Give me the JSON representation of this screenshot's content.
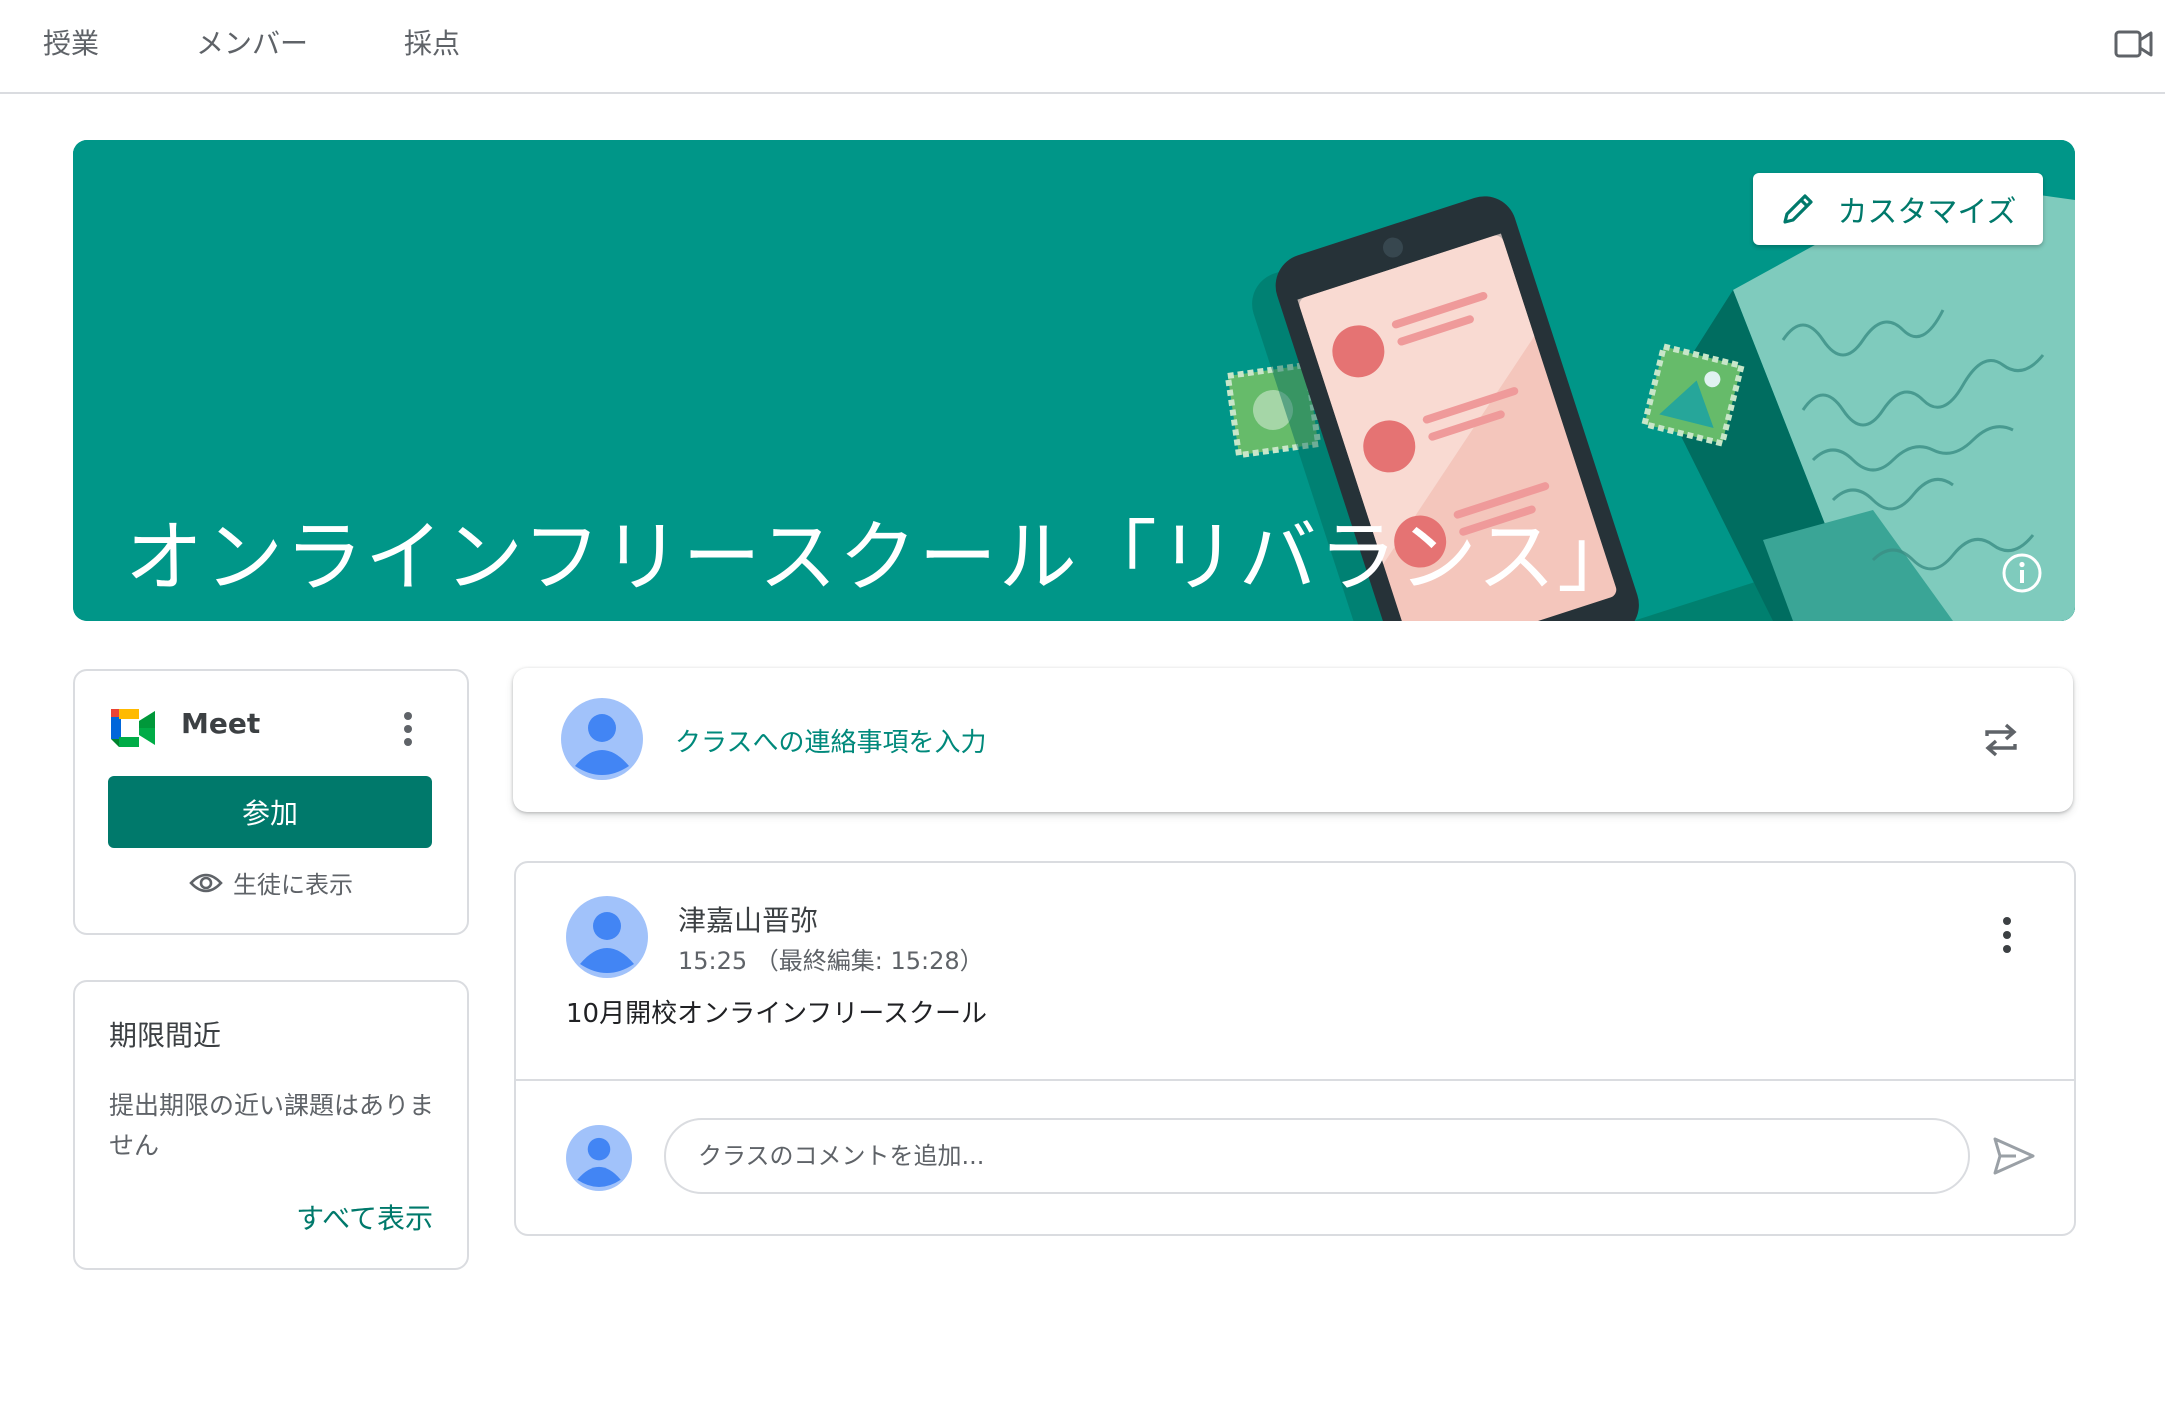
{
  "nav": {
    "tabs": [
      {
        "label": "授業"
      },
      {
        "label": "メンバー"
      },
      {
        "label": "採点"
      }
    ],
    "right_icon": "video-camera-icon"
  },
  "banner": {
    "title": "オンラインフリースクール「リバランス」",
    "customize_label": "カスタマイズ",
    "customize_icon": "pencil-icon",
    "info_icon": "info-icon",
    "color": "#009688"
  },
  "meet": {
    "label": "Meet",
    "join_label": "参加",
    "show_students_label": "生徒に表示",
    "show_icon": "eye-icon",
    "more_icon": "more-vert-icon"
  },
  "upcoming": {
    "title": "期限間近",
    "empty_text": "提出期限の近い課題はありません",
    "view_all_label": "すべて表示"
  },
  "announce": {
    "placeholder": "クラスへの連絡事項を入力",
    "repost_icon": "repost-icon"
  },
  "post": {
    "author": "津嘉山晋弥",
    "time": "15:25 （最終編集: 15:28）",
    "body": "10月開校オンラインフリースクール",
    "comment_placeholder": "クラスのコメントを追加...",
    "send_icon": "send-icon"
  },
  "colors": {
    "accent": "#00796b",
    "link": "#00897b",
    "border": "#dadce0",
    "avatar_bg": "#a1c2fa",
    "avatar_fg": "#4285f4"
  }
}
